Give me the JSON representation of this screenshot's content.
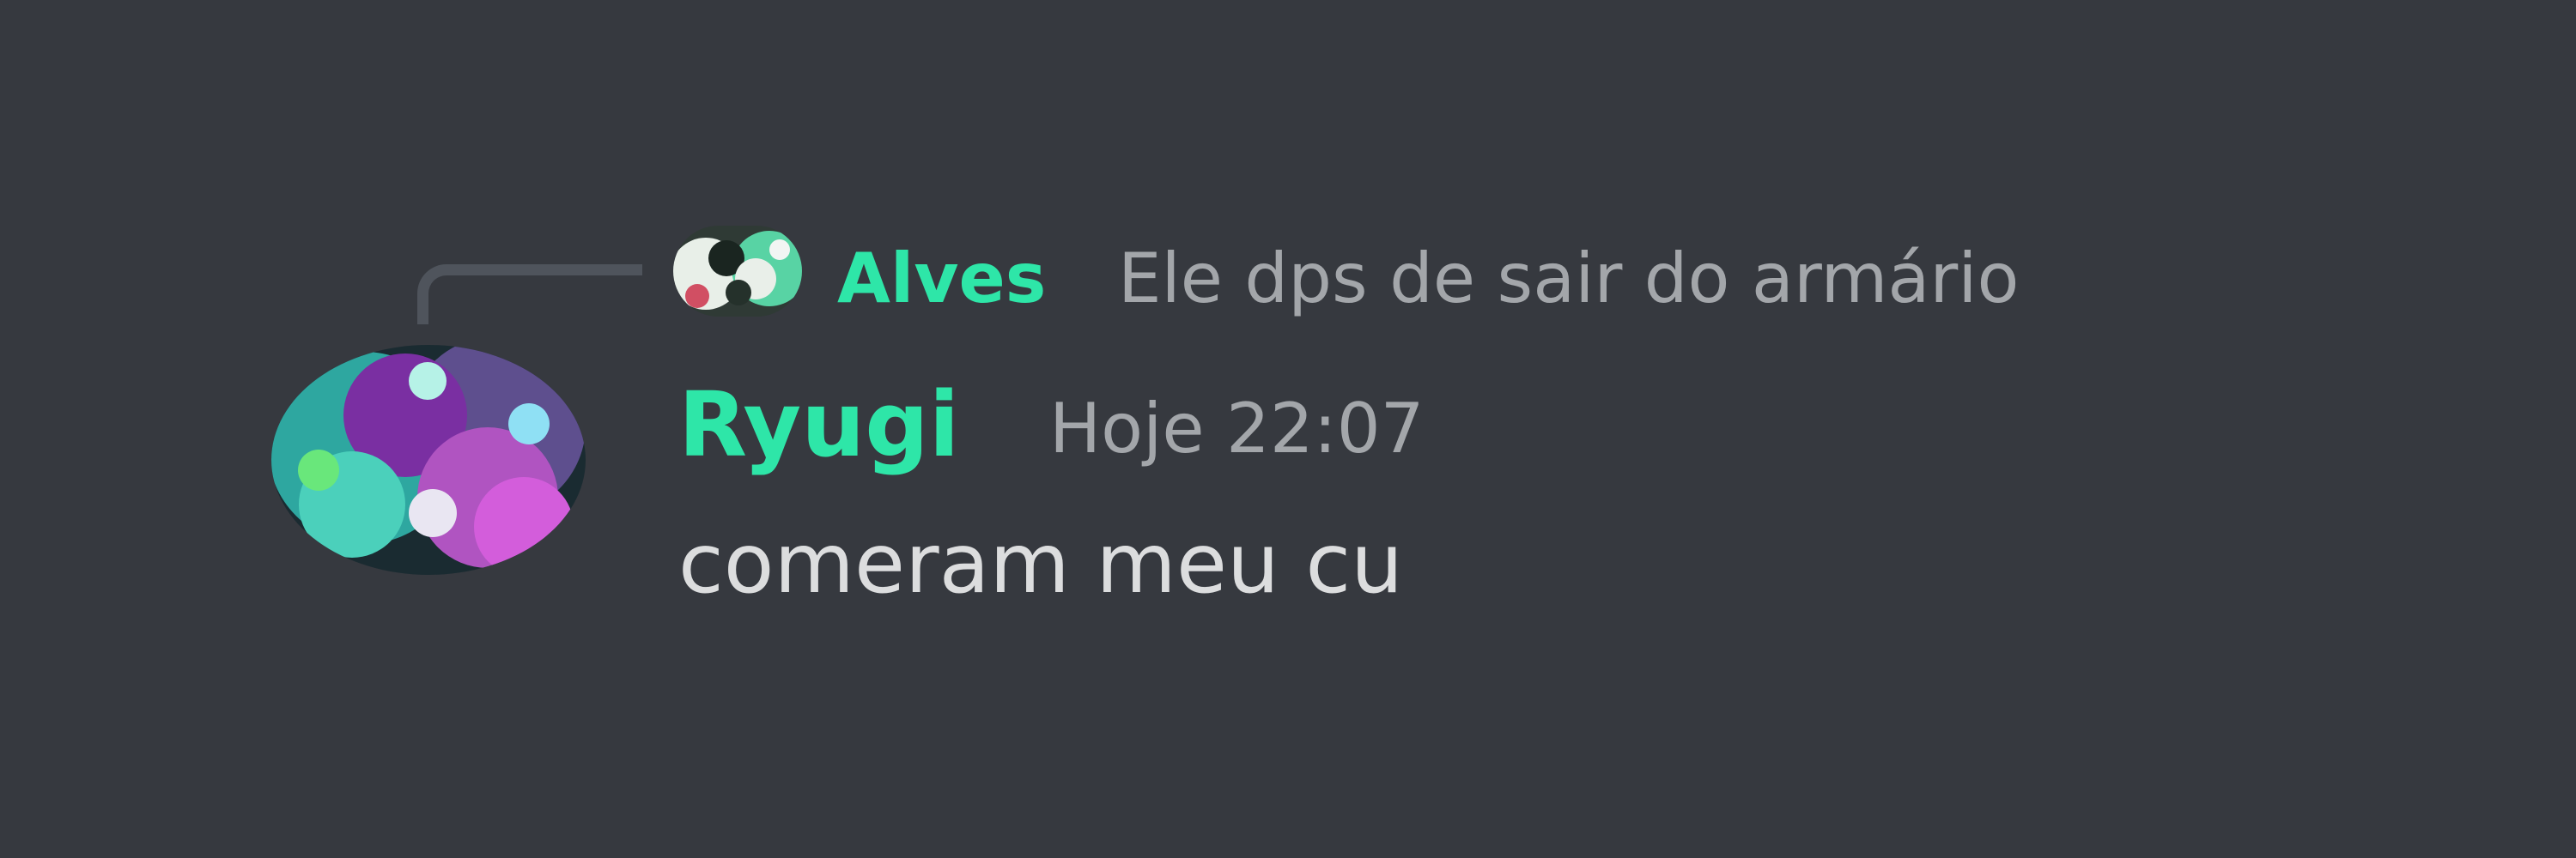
{
  "reply": {
    "author": "Alves",
    "content": "Ele dps de sair do armário",
    "avatar_icon": "user-avatar-icon"
  },
  "message": {
    "author": "Ryugi",
    "timestamp": "Hoje 22:07",
    "content": "comeram meu cu",
    "avatar_icon": "user-avatar-icon"
  },
  "colors": {
    "background": "#36393f",
    "username": "#2ee6a8",
    "muted_text": "#a3a6aa",
    "message_text": "#dcddde",
    "reply_spine": "#4f545c"
  }
}
